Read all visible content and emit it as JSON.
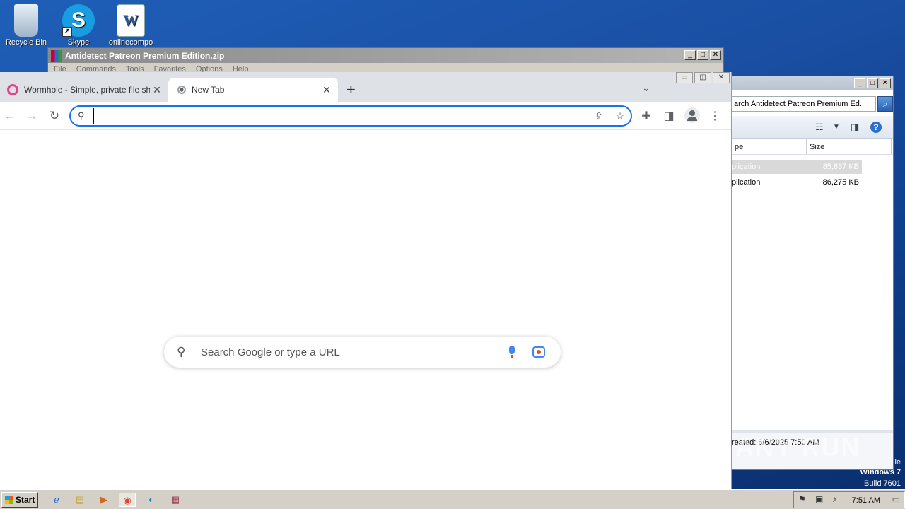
{
  "desktop": {
    "icons": [
      {
        "label": "Recycle Bin",
        "glyph": ""
      },
      {
        "label": "Skype",
        "glyph": "S"
      },
      {
        "label": "onlinecompo",
        "glyph": "W"
      }
    ],
    "brand_line1": "Windows 7",
    "brand_line2": "Build 7601",
    "brand_fragment": "le"
  },
  "winrar": {
    "title": "Antidetect Patreon Premium Edition.zip",
    "menus": [
      "File",
      "Commands",
      "Tools",
      "Favorites",
      "Options",
      "Help"
    ],
    "controls": [
      "_",
      "□",
      "✕"
    ]
  },
  "explorer": {
    "search_text": "arch Antidetect Patreon Premium Ed...",
    "columns": [
      "pe",
      "Size"
    ],
    "rows": [
      {
        "type": "plication",
        "size": "85,837 KB",
        "selected": true
      },
      {
        "type": "plication",
        "size": "86,275 KB",
        "selected": false
      }
    ],
    "details": "reated: 6/6/2025 7:50 AM",
    "watermark": "ANY RUN",
    "controls": [
      "_",
      "□",
      "✕"
    ]
  },
  "chrome": {
    "tabs": [
      {
        "title": "Wormhole - Simple, private file sharing",
        "icon": "wormhole-icon"
      },
      {
        "title": "New Tab",
        "icon": "chrome-icon"
      }
    ],
    "new_tab_glyph": "+",
    "window_controls": [
      "▭",
      "◫",
      "✕"
    ],
    "omnibox": {
      "value": "",
      "placeholder": ""
    },
    "ntp_search_placeholder": "Search Google or type a URL"
  },
  "taskbar": {
    "start_label": "Start",
    "clock": "7:51 AM",
    "apps": [
      "ie-icon",
      "explorer-icon",
      "media-player-icon",
      "chrome-icon",
      "edge-icon",
      "winrar-icon"
    ]
  },
  "colors": {
    "accent": "#1a73e8",
    "desktop": "#1a4fa3",
    "taskbar": "#d4d0c8"
  }
}
